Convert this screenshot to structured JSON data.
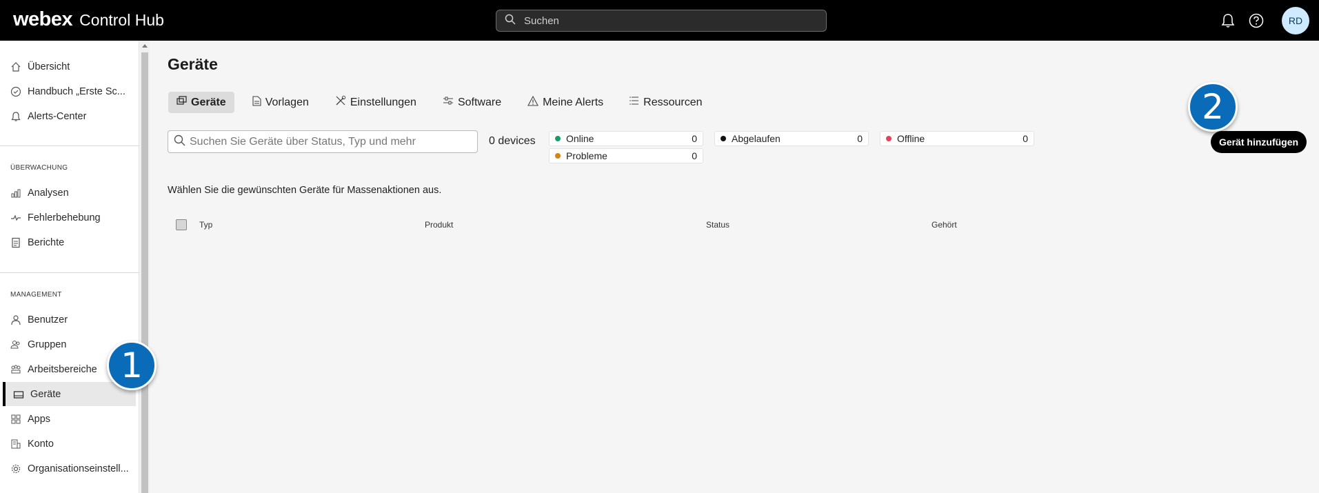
{
  "header": {
    "brand_main": "webex",
    "brand_sub": "Control Hub",
    "search_placeholder": "Suchen",
    "avatar_initials": "RD"
  },
  "sidebar": {
    "top_items": [
      {
        "label": "Übersicht",
        "icon": "home-icon"
      },
      {
        "label": "Handbuch „Erste Sc...",
        "icon": "check-circle-icon"
      },
      {
        "label": "Alerts-Center",
        "icon": "bell-icon"
      }
    ],
    "monitoring_title": "ÜBERWACHUNG",
    "monitoring_items": [
      {
        "label": "Analysen",
        "icon": "analytics-icon"
      },
      {
        "label": "Fehlerbehebung",
        "icon": "pulse-icon"
      },
      {
        "label": "Berichte",
        "icon": "report-icon"
      }
    ],
    "management_title": "MANAGEMENT",
    "management_items": [
      {
        "label": "Benutzer",
        "icon": "user-icon"
      },
      {
        "label": "Gruppen",
        "icon": "group-icon"
      },
      {
        "label": "Arbeitsbereiche",
        "icon": "workspace-icon"
      },
      {
        "label": "Geräte",
        "icon": "device-icon",
        "active": true
      },
      {
        "label": "Apps",
        "icon": "apps-icon"
      },
      {
        "label": "Konto",
        "icon": "building-icon"
      },
      {
        "label": "Organisationseinstell...",
        "icon": "gear-icon"
      }
    ]
  },
  "main": {
    "title": "Geräte",
    "tabs": [
      {
        "label": "Geräte",
        "icon": "devices-icon",
        "active": true
      },
      {
        "label": "Vorlagen",
        "icon": "document-icon"
      },
      {
        "label": "Einstellungen",
        "icon": "tools-icon"
      },
      {
        "label": "Software",
        "icon": "sliders-icon"
      },
      {
        "label": "Meine Alerts",
        "icon": "warning-icon"
      },
      {
        "label": "Ressourcen",
        "icon": "list-icon"
      }
    ],
    "search_placeholder": "Suchen Sie Geräte über Status, Typ und mehr",
    "device_count": "0 devices",
    "status": [
      {
        "label": "Online",
        "count": "0",
        "color": "#1d9a6c"
      },
      {
        "label": "Abgelaufen",
        "count": "0",
        "color": "#111111"
      },
      {
        "label": "Offline",
        "count": "0",
        "color": "#e0455a"
      },
      {
        "label": "Probleme",
        "count": "0",
        "color": "#d4860f"
      }
    ],
    "add_button": "Gerät hinzufügen",
    "hint": "Wählen Sie die gewünschten Geräte für Massenaktionen aus.",
    "columns": [
      "Typ",
      "Produkt",
      "Status",
      "Gehört"
    ]
  },
  "callouts": [
    "1",
    "2"
  ],
  "colors": {
    "accent": "#0a6bb8",
    "topbar": "#000000",
    "active_nav": "#e8e8e8"
  }
}
